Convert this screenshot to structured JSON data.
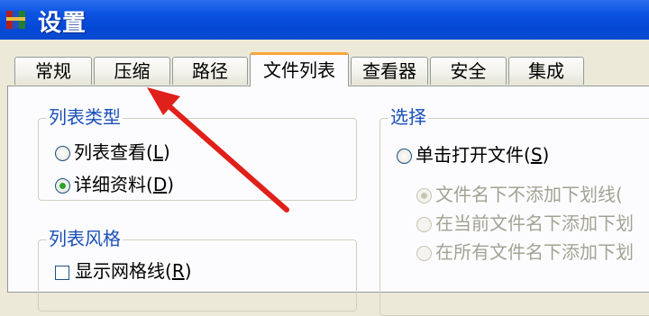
{
  "window": {
    "title": "设置",
    "icon": "winrar-books-icon"
  },
  "tabs": [
    {
      "label": "常规",
      "active": false
    },
    {
      "label": "压缩",
      "active": false
    },
    {
      "label": "路径",
      "active": false
    },
    {
      "label": "文件列表",
      "active": true
    },
    {
      "label": "查看器",
      "active": false
    },
    {
      "label": "安全",
      "active": false
    },
    {
      "label": "集成",
      "active": false
    }
  ],
  "list_type": {
    "title": "列表类型",
    "options": [
      {
        "label": "列表查看(",
        "hotkey": "L",
        "suffix": ")",
        "checked": false
      },
      {
        "label": "详细资料(",
        "hotkey": "D",
        "suffix": ")",
        "checked": true
      }
    ]
  },
  "list_style": {
    "title": "列表风格",
    "show_grid": {
      "label": "显示网格线(",
      "hotkey": "R",
      "suffix": ")",
      "checked": false
    }
  },
  "selection": {
    "title": "选择",
    "single_click": {
      "label": "单击打开文件(",
      "hotkey": "S",
      "suffix": ")",
      "checked": false
    },
    "sub_options": [
      {
        "label": "文件名下不添加下划线(",
        "checked": true
      },
      {
        "label": "在当前文件名下添加下划",
        "checked": false
      },
      {
        "label": "在所有文件名下添加下划",
        "checked": false
      }
    ]
  },
  "colors": {
    "titlebar": "#0548d6",
    "group_title": "#1a4fb8",
    "active_tab_accent": "#f9a43a",
    "arrow": "#e0201a",
    "radio_dot": "#2aa42a"
  }
}
